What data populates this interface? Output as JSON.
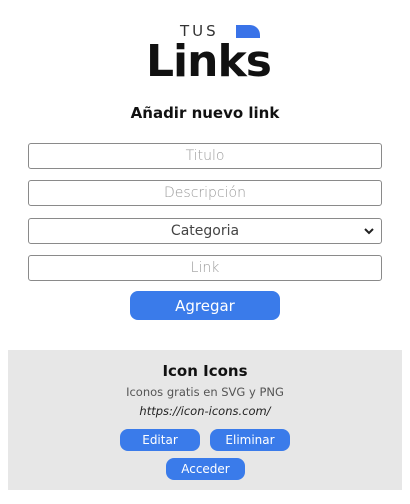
{
  "logo": {
    "top_text": "TUS",
    "main_text": "Links",
    "accent_color": "#3a73e8"
  },
  "form": {
    "title": "Añadir nuevo link",
    "title_placeholder": "Titulo",
    "description_placeholder": "Descripción",
    "category_selected": "Categoria",
    "link_placeholder": "Link",
    "submit_label": "Agregar"
  },
  "card": {
    "title": "Icon Icons",
    "description": "Iconos gratis en SVG y PNG",
    "url": "https://icon-icons.com/",
    "edit_label": "Editar",
    "delete_label": "Eliminar",
    "access_label": "Acceder"
  },
  "colors": {
    "button": "#3a7bea",
    "card_bg": "#e7e7e7"
  }
}
